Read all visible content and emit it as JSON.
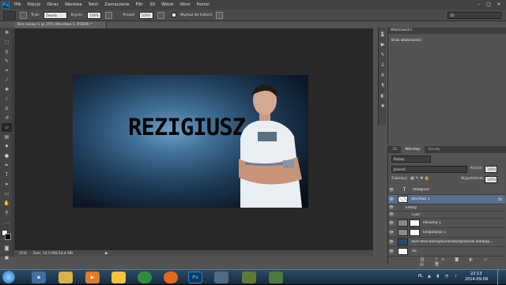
{
  "menubar": {
    "logo": "Ps",
    "items": [
      "Plik",
      "Edycja",
      "Obraz",
      "Warstwa",
      "Tekst",
      "Zaznaczenie",
      "Filtr",
      "3D",
      "Widok",
      "Okno",
      "Pomoc"
    ]
  },
  "options": {
    "mode_label": "Tryb:",
    "mode_value": "Zwykły",
    "opacity_label": "Krycie:",
    "opacity_value": "100%",
    "flow_label": "Przepł:",
    "flow_value": "100%",
    "history_label": "Wymaż do historii",
    "workspace_value": "3D"
  },
  "document": {
    "tab_title": "Bez nazwy-1 @ 25% (Warstwa 1, RGB/8) *",
    "art_text": "REZIGIUSZ"
  },
  "status": {
    "zoom": "25%",
    "doc_info": "Dok: 10,5 MB/16,4 MB"
  },
  "properties": {
    "tab_label": "Właściwości",
    "message": "Brak właściwości"
  },
  "layers": {
    "tabs": [
      "3D",
      "Warstwy",
      "Kanały"
    ],
    "filter_value": "Rodzaj",
    "blend_value": "Jasność",
    "opacity_label": "Krycie:",
    "opacity_value": "100%",
    "lock_label": "Zablokuj:",
    "fill_label": "Wypełnienie:",
    "fill_value": "100%",
    "rows": [
      {
        "name": "Rezigiusz"
      },
      {
        "name": "Warstwa 1"
      },
      {
        "name": "Efekty"
      },
      {
        "name": "Cień"
      },
      {
        "name": "Poziomy 1"
      },
      {
        "name": "Ekspozycja 1"
      },
      {
        "name": "dark-blue-background-backgrounds-wallpap..."
      },
      {
        "name": "Tło"
      }
    ]
  },
  "taskbar": {
    "lang": "PL",
    "time": "22:13",
    "date": "2014-09-09"
  }
}
